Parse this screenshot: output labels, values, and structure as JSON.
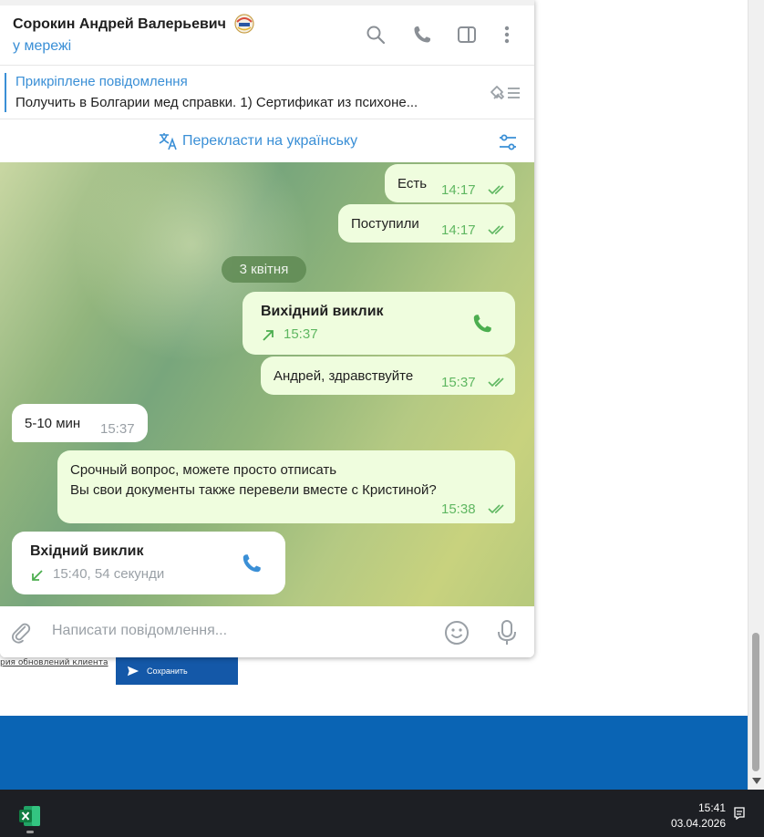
{
  "chat_header": {
    "name": "Сорокин Андрей Валерьевич",
    "status": "у мережі"
  },
  "pinned": {
    "title": "Прикріплене повідомлення",
    "text": "Получить в Болгарии мед справки.  1) Сертификат из психоне..."
  },
  "translate": {
    "label": "Перекласти на українську"
  },
  "messages": [
    {
      "direction": "out",
      "text": "Есть",
      "time": "14:17",
      "read": true
    },
    {
      "direction": "out",
      "text": "Поступили",
      "time": "14:17",
      "read": true
    },
    {
      "type": "date",
      "text": "3 квітня"
    },
    {
      "direction": "out",
      "type": "call",
      "title": "Вихідний виклик",
      "detail": "15:37"
    },
    {
      "direction": "out",
      "text": "Андрей, здравствуйте",
      "time": "15:37",
      "read": true
    },
    {
      "direction": "in",
      "text": "5-10 мин",
      "time": "15:37"
    },
    {
      "direction": "out",
      "line1": "Срочный вопрос, можете просто отписать",
      "line2": "Вы свои документы также перевели вместе с Кристиной?",
      "time": "15:38",
      "read": true
    },
    {
      "direction": "in",
      "type": "call",
      "title": "Вхідний виклик",
      "detail": "15:40, 54 секунди"
    }
  ],
  "composer": {
    "placeholder": "Написати повідомлення..."
  },
  "background_app": {
    "link_text": "рия обновлений клиента",
    "save_button": "Сохранить"
  },
  "taskbar": {
    "time": "15:41",
    "date": "03.04.2026",
    "app": "excel-icon"
  },
  "colors": {
    "accent": "#3a8fd6",
    "outgoing_bubble": "#effdde",
    "read_check": "#5fb761",
    "call_icon": "#4cae4f",
    "taskbar": "#1d1f24",
    "blue_band": "#0a64b4"
  }
}
